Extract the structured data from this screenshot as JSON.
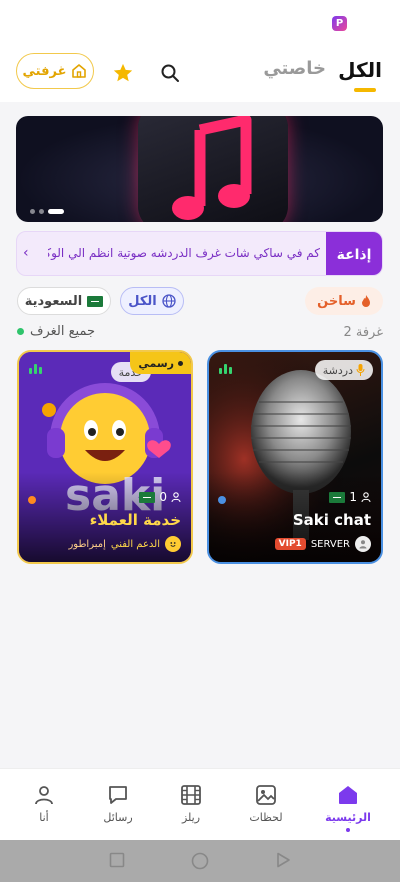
{
  "header": {
    "tab_all": "الكل",
    "tab_private": "خاصتي",
    "my_room_label": "غرفتي"
  },
  "banner": {
    "slide_count": 3,
    "active_slide": 1
  },
  "announcement": {
    "tag": "إذاعة",
    "text": "كم في ساكي شات غرف الدردشه صوتية انظم الي الوكالات وعروض",
    "arrow": "‹"
  },
  "filters": {
    "hot_label": "ساخن",
    "all_label": "الكل",
    "country_label": "السعودية"
  },
  "section": {
    "title": "جميع الغرف",
    "count": "2 غرفة"
  },
  "rooms": [
    {
      "category": "دردشة",
      "members": "1",
      "name": "Saki chat",
      "owner_label": "SERVER",
      "vip": "VIP1"
    },
    {
      "official": "رسمي",
      "category": "خدمة",
      "members": "0",
      "name": "خدمة العملاء",
      "owner_label": "الدعم الفني",
      "rank": "إمبراطور",
      "logo_text": "saki"
    }
  ],
  "nav": {
    "home": "الرئيسية",
    "moments": "لحظات",
    "reels": "ريلز",
    "messages": "رسائل",
    "me": "أنا"
  },
  "colors": {
    "accent": "#7c3aed",
    "gold": "#f2c94c",
    "hot": "#e4602a"
  }
}
